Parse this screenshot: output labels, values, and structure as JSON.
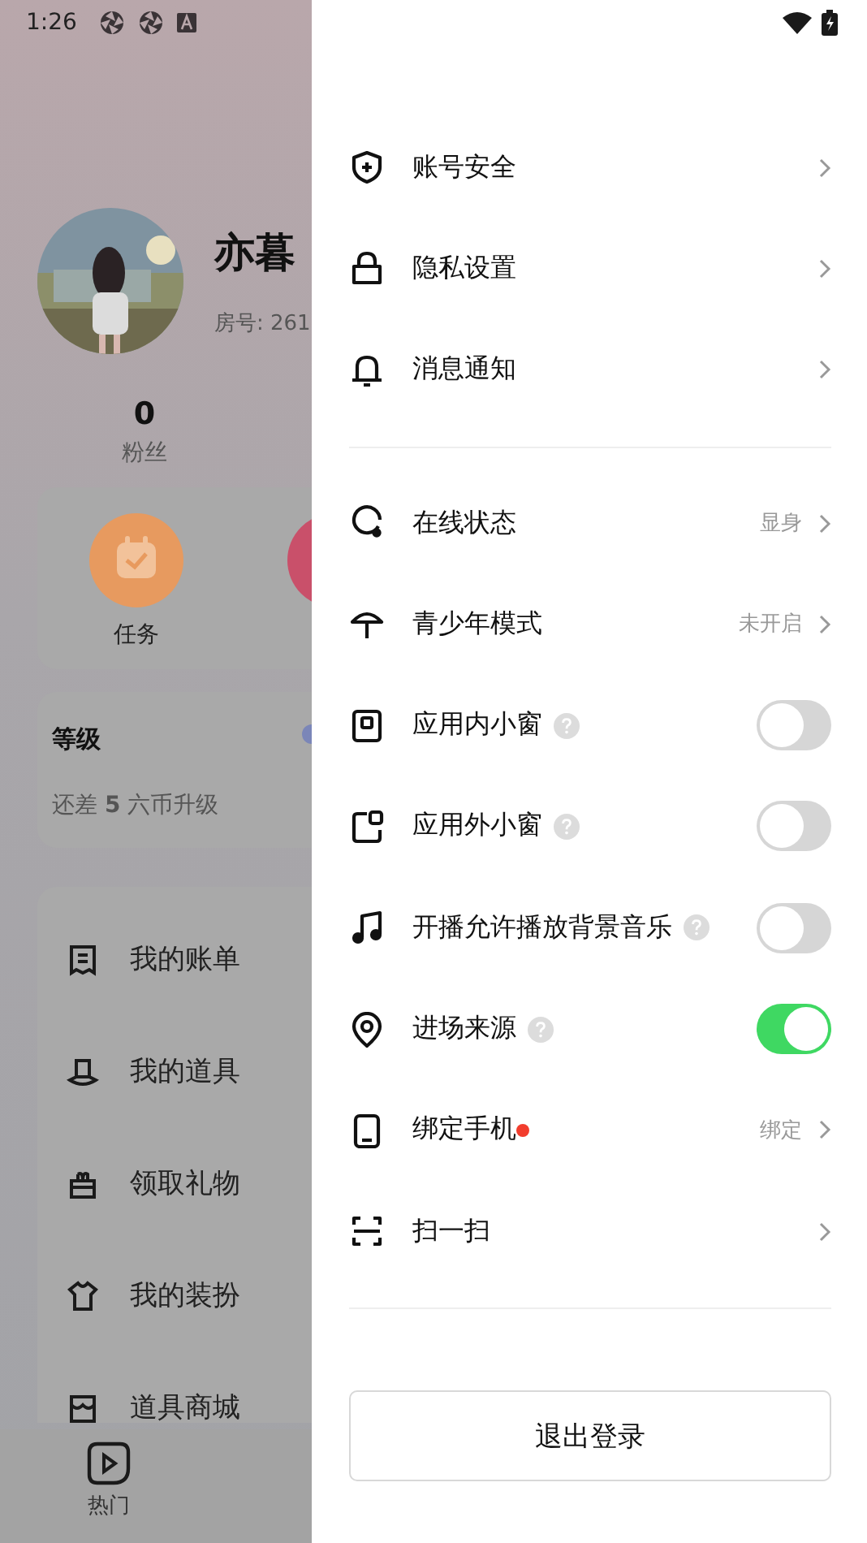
{
  "status_bar": {
    "time": "1:26"
  },
  "profile": {
    "name": "亦暮",
    "room_id": "房号: 261",
    "fans_count": "0",
    "fans_label": "粉丝"
  },
  "quick_actions": [
    {
      "label": "任务"
    }
  ],
  "level_card": {
    "title": "等级",
    "progress_text": "还差 **5** 六币升级"
  },
  "menu": [
    {
      "label": "我的账单"
    },
    {
      "label": "我的道具"
    },
    {
      "label": "领取礼物"
    },
    {
      "label": "我的装扮"
    },
    {
      "label": "道具商城"
    }
  ],
  "bottom_nav": [
    {
      "label": "热门"
    }
  ],
  "drawer": {
    "groups": [
      [
        {
          "kind": "link",
          "label": "账号安全",
          "dot": false
        },
        {
          "kind": "link",
          "label": "隐私设置",
          "dot": false
        },
        {
          "kind": "link",
          "label": "消息通知",
          "dot": false
        }
      ],
      [
        {
          "kind": "link",
          "label": "在线状态",
          "value": "显身",
          "dot": false
        },
        {
          "kind": "link",
          "label": "青少年模式",
          "value": "未开启",
          "dot": false
        },
        {
          "kind": "toggle",
          "label": "应用内小窗",
          "help": true,
          "on": false
        },
        {
          "kind": "toggle",
          "label": "应用外小窗",
          "help": true,
          "on": false
        },
        {
          "kind": "toggle",
          "label": "开播允许播放背景音乐",
          "help": true,
          "on": false
        },
        {
          "kind": "toggle",
          "label": "进场来源",
          "help": true,
          "on": true
        },
        {
          "kind": "link",
          "label": "绑定手机",
          "value": "绑定",
          "dot": true
        },
        {
          "kind": "link",
          "label": "扫一扫",
          "dot": false
        }
      ]
    ],
    "logout_button": "退出登录"
  }
}
